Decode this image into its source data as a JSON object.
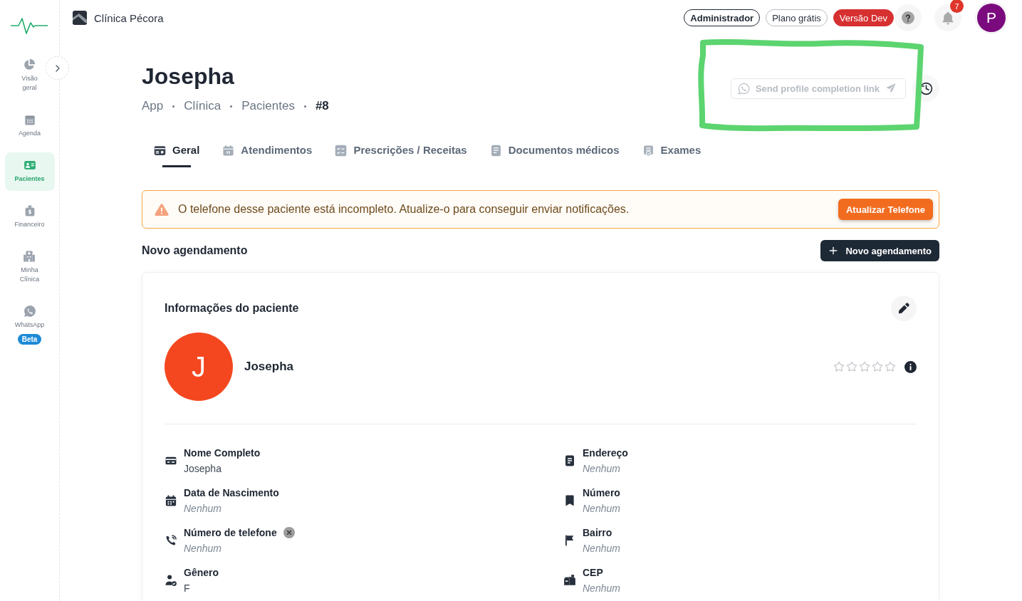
{
  "sidebar": {
    "items": [
      {
        "label": "Visão geral",
        "selected": false
      },
      {
        "label": "Agenda",
        "selected": false
      },
      {
        "label": "Pacientes",
        "selected": true
      },
      {
        "label": "Financeiro",
        "selected": false
      },
      {
        "label": "Minha Clínica",
        "selected": false
      },
      {
        "label": "WhatsApp",
        "selected": false,
        "badge": "Beta"
      }
    ]
  },
  "header": {
    "clinic_name": "Clínica Pécora",
    "badges": [
      {
        "label": "Administrador",
        "kind": "role"
      },
      {
        "label": "Plano grátis",
        "kind": "plan"
      },
      {
        "label": "Versão Dev",
        "kind": "env"
      }
    ],
    "notifications_count": "7",
    "avatar_initial": "P"
  },
  "page": {
    "title": "Josepha",
    "breadcrumb": [
      "App",
      "Clínica",
      "Pacientes",
      "#8"
    ],
    "send_link_button": {
      "label": "Send profile completion link",
      "disabled": true
    }
  },
  "tabs": [
    {
      "label": "Geral",
      "selected": true
    },
    {
      "label": "Atendimentos",
      "selected": false
    },
    {
      "label": "Prescrições / Receitas",
      "selected": false
    },
    {
      "label": "Documentos médicos",
      "selected": false
    },
    {
      "label": "Exames",
      "selected": false
    }
  ],
  "alert": {
    "message": "O telefone desse paciente está incompleto. Atualize-o para conseguir enviar notificações.",
    "button": "Atualizar Telefone"
  },
  "appointments": {
    "heading": "Novo agendamento",
    "button": "Novo agendamento"
  },
  "patient_card": {
    "title": "Informações do paciente",
    "initial": "J",
    "name": "Josepha",
    "stars": 0,
    "fields": [
      {
        "label": "Nome Completo",
        "value": "Josepha",
        "empty": false,
        "invalid": false
      },
      {
        "label": "Endereço",
        "value": "Nenhum",
        "empty": true,
        "invalid": false
      },
      {
        "label": "Data de Nascimento",
        "value": "Nenhum",
        "empty": true,
        "invalid": false
      },
      {
        "label": "Número",
        "value": "Nenhum",
        "empty": true,
        "invalid": false
      },
      {
        "label": "Número de telefone",
        "value": "Nenhum",
        "empty": true,
        "invalid": true
      },
      {
        "label": "Bairro",
        "value": "Nenhum",
        "empty": true,
        "invalid": false
      },
      {
        "label": "Gênero",
        "value": "F",
        "empty": false,
        "invalid": false
      },
      {
        "label": "CEP",
        "value": "Nenhum",
        "empty": true,
        "invalid": false
      }
    ]
  }
}
